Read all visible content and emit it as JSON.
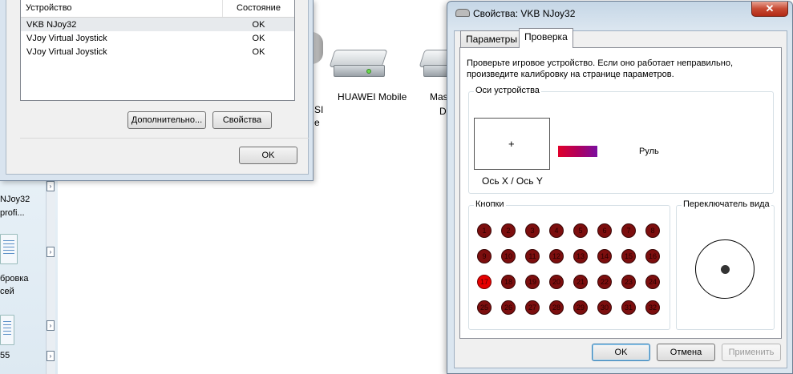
{
  "left_dialog": {
    "list_headers": {
      "device": "Устройство",
      "status": "Состояние"
    },
    "devices": [
      {
        "name": "VKB NJoy32",
        "status": "OK"
      },
      {
        "name": "VJoy Virtual Joystick",
        "status": "OK"
      },
      {
        "name": "VJoy Virtual Joystick",
        "status": "OK"
      }
    ],
    "advanced_button": "Дополнительно...",
    "properties_button": "Свойства",
    "ok_button": "OK"
  },
  "desktop": {
    "labels": [
      "NJoy32",
      "profi...",
      "бровка",
      "сей",
      "55"
    ],
    "fragments": [
      "SI",
      "e",
      "Mas",
      "D"
    ]
  },
  "drives": [
    {
      "label": "HUAWEI Mobile"
    }
  ],
  "right_dialog": {
    "title": "Свойства: VKB NJoy32",
    "close_glyph": "✕",
    "tabs": [
      "Параметры",
      "Проверка"
    ],
    "active_tab": "Проверка",
    "instructions": "Проверьте игровое устройство. Если оно работает неправильно, произведите калибровку на странице параметров.",
    "axes_group": {
      "title": "Оси устройства",
      "crosshair": "+",
      "xy_label": "Ось X / Ось Y",
      "wheel_label": "Руль",
      "wheel_color": "#b0005c"
    },
    "buttons_group": {
      "title": "Кнопки",
      "buttons": [
        {
          "n": "1",
          "on": false
        },
        {
          "n": "2",
          "on": false
        },
        {
          "n": "3",
          "on": false
        },
        {
          "n": "4",
          "on": false
        },
        {
          "n": "5",
          "on": false
        },
        {
          "n": "6",
          "on": false
        },
        {
          "n": "7",
          "on": false
        },
        {
          "n": "8",
          "on": false
        },
        {
          "n": "9",
          "on": false
        },
        {
          "n": "10",
          "on": false
        },
        {
          "n": "11",
          "on": false
        },
        {
          "n": "12",
          "on": false
        },
        {
          "n": "13",
          "on": false
        },
        {
          "n": "14",
          "on": false
        },
        {
          "n": "15",
          "on": false
        },
        {
          "n": "16",
          "on": false
        },
        {
          "n": "17",
          "on": true
        },
        {
          "n": "18",
          "on": false
        },
        {
          "n": "19",
          "on": false
        },
        {
          "n": "20",
          "on": false
        },
        {
          "n": "21",
          "on": false
        },
        {
          "n": "22",
          "on": false
        },
        {
          "n": "23",
          "on": false
        },
        {
          "n": "24",
          "on": false
        },
        {
          "n": "25",
          "on": false
        },
        {
          "n": "26",
          "on": false
        },
        {
          "n": "27",
          "on": false
        },
        {
          "n": "28",
          "on": false
        },
        {
          "n": "29",
          "on": false
        },
        {
          "n": "30",
          "on": false
        },
        {
          "n": "31",
          "on": false
        },
        {
          "n": "32",
          "on": false
        }
      ],
      "off_color": "#7c0e0e",
      "on_color": "#e60000"
    },
    "pov_group": {
      "title": "Переключатель вида"
    },
    "ok_button": "OK",
    "cancel_button": "Отмена",
    "apply_button": "Применить"
  }
}
